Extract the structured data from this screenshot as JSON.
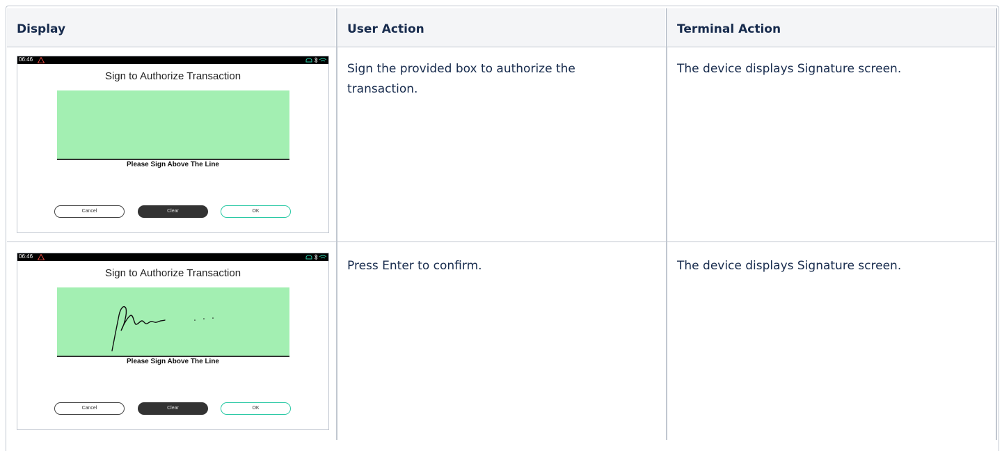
{
  "table": {
    "headers": [
      "Display",
      "User Action",
      "Terminal Action"
    ],
    "rows": [
      {
        "display": {
          "status_time": "06:46",
          "title": "Sign to Authorize Transaction",
          "signature_label": "Please Sign Above The Line",
          "buttons": [
            "Cancel",
            "Clear",
            "OK"
          ],
          "signed": false
        },
        "user_action": "Sign the provided box to authorize the transaction.",
        "terminal_action": "The device displays Signature screen."
      },
      {
        "display": {
          "status_time": "06:46",
          "title": "Sign to Authorize Transaction",
          "signature_label": "Please Sign Above The Line",
          "buttons": [
            "Cancel",
            "Clear",
            "OK"
          ],
          "signed": true
        },
        "user_action": "Press Enter to confirm.",
        "terminal_action": "The device displays Signature screen."
      }
    ]
  },
  "colors": {
    "header_bg": "#f4f5f7",
    "border": "#c1c7d0",
    "signature_box": "#a3efb2",
    "ok_border": "#2bc9a5",
    "warning": "#e5483f",
    "status_icons": "#2bc9a5"
  },
  "icons": [
    "warning-icon",
    "cloud-icon",
    "bluetooth-icon",
    "wifi-icon"
  ]
}
